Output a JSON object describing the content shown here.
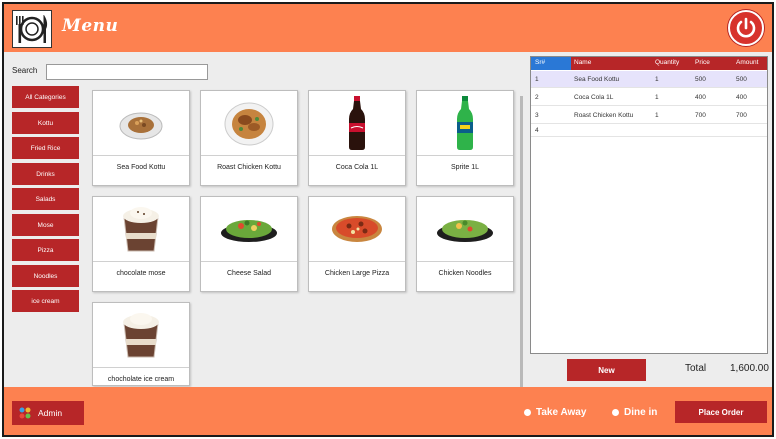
{
  "header": {
    "title": "Menu",
    "logo_icon": "plate-fork-knife-icon",
    "power_icon": "power-icon",
    "accent_color": "#fd8150"
  },
  "search": {
    "label": "Search",
    "value": "",
    "placeholder": ""
  },
  "categories": [
    {
      "label": "All Categories"
    },
    {
      "label": "Kottu"
    },
    {
      "label": "Fried Rice"
    },
    {
      "label": "Drinks"
    },
    {
      "label": "Salads"
    },
    {
      "label": "Mose"
    },
    {
      "label": "Pizza"
    },
    {
      "label": "Noodles"
    },
    {
      "label": "ice cream"
    }
  ],
  "products": [
    {
      "name": "Sea Food Kottu",
      "icon": "kottu-plate-icon"
    },
    {
      "name": "Roast Chicken Kottu",
      "icon": "chicken-plate-icon"
    },
    {
      "name": "Coca Cola 1L",
      "icon": "cola-bottle-icon"
    },
    {
      "name": "Sprite 1L",
      "icon": "sprite-bottle-icon"
    },
    {
      "name": "chocolate mose",
      "icon": "mousse-cup-icon"
    },
    {
      "name": "Cheese Salad",
      "icon": "salad-bowl-icon"
    },
    {
      "name": "Chicken Large Pizza",
      "icon": "pizza-icon"
    },
    {
      "name": "Chicken Noodles",
      "icon": "noodles-bowl-icon"
    },
    {
      "name": "chocholate ice cream",
      "icon": "icecream-cup-icon"
    }
  ],
  "order": {
    "columns": [
      "Sr#",
      "Name",
      "Quantity",
      "Price",
      "Amount"
    ],
    "rows": [
      {
        "sr": "1",
        "name": "Sea Food Kottu",
        "qty": "1",
        "price": "500",
        "amount": "500"
      },
      {
        "sr": "2",
        "name": "Coca Cola 1L",
        "qty": "1",
        "price": "400",
        "amount": "400"
      },
      {
        "sr": "3",
        "name": "Roast Chicken Kottu",
        "qty": "1",
        "price": "700",
        "amount": "700"
      },
      {
        "sr": "4",
        "name": "",
        "qty": "",
        "price": "",
        "amount": ""
      }
    ]
  },
  "buttons": {
    "new": "New",
    "place_order": "Place Order",
    "admin": "Admin"
  },
  "total": {
    "label": "Total",
    "value": "1,600.00"
  },
  "order_type": {
    "take_away": "Take Away",
    "dine_in": "Dine in"
  },
  "colors": {
    "primary_red": "#b72628",
    "header_orange": "#fd8150",
    "selected_row": "#e6e3fb",
    "sr_header_blue": "#2a78d6"
  }
}
